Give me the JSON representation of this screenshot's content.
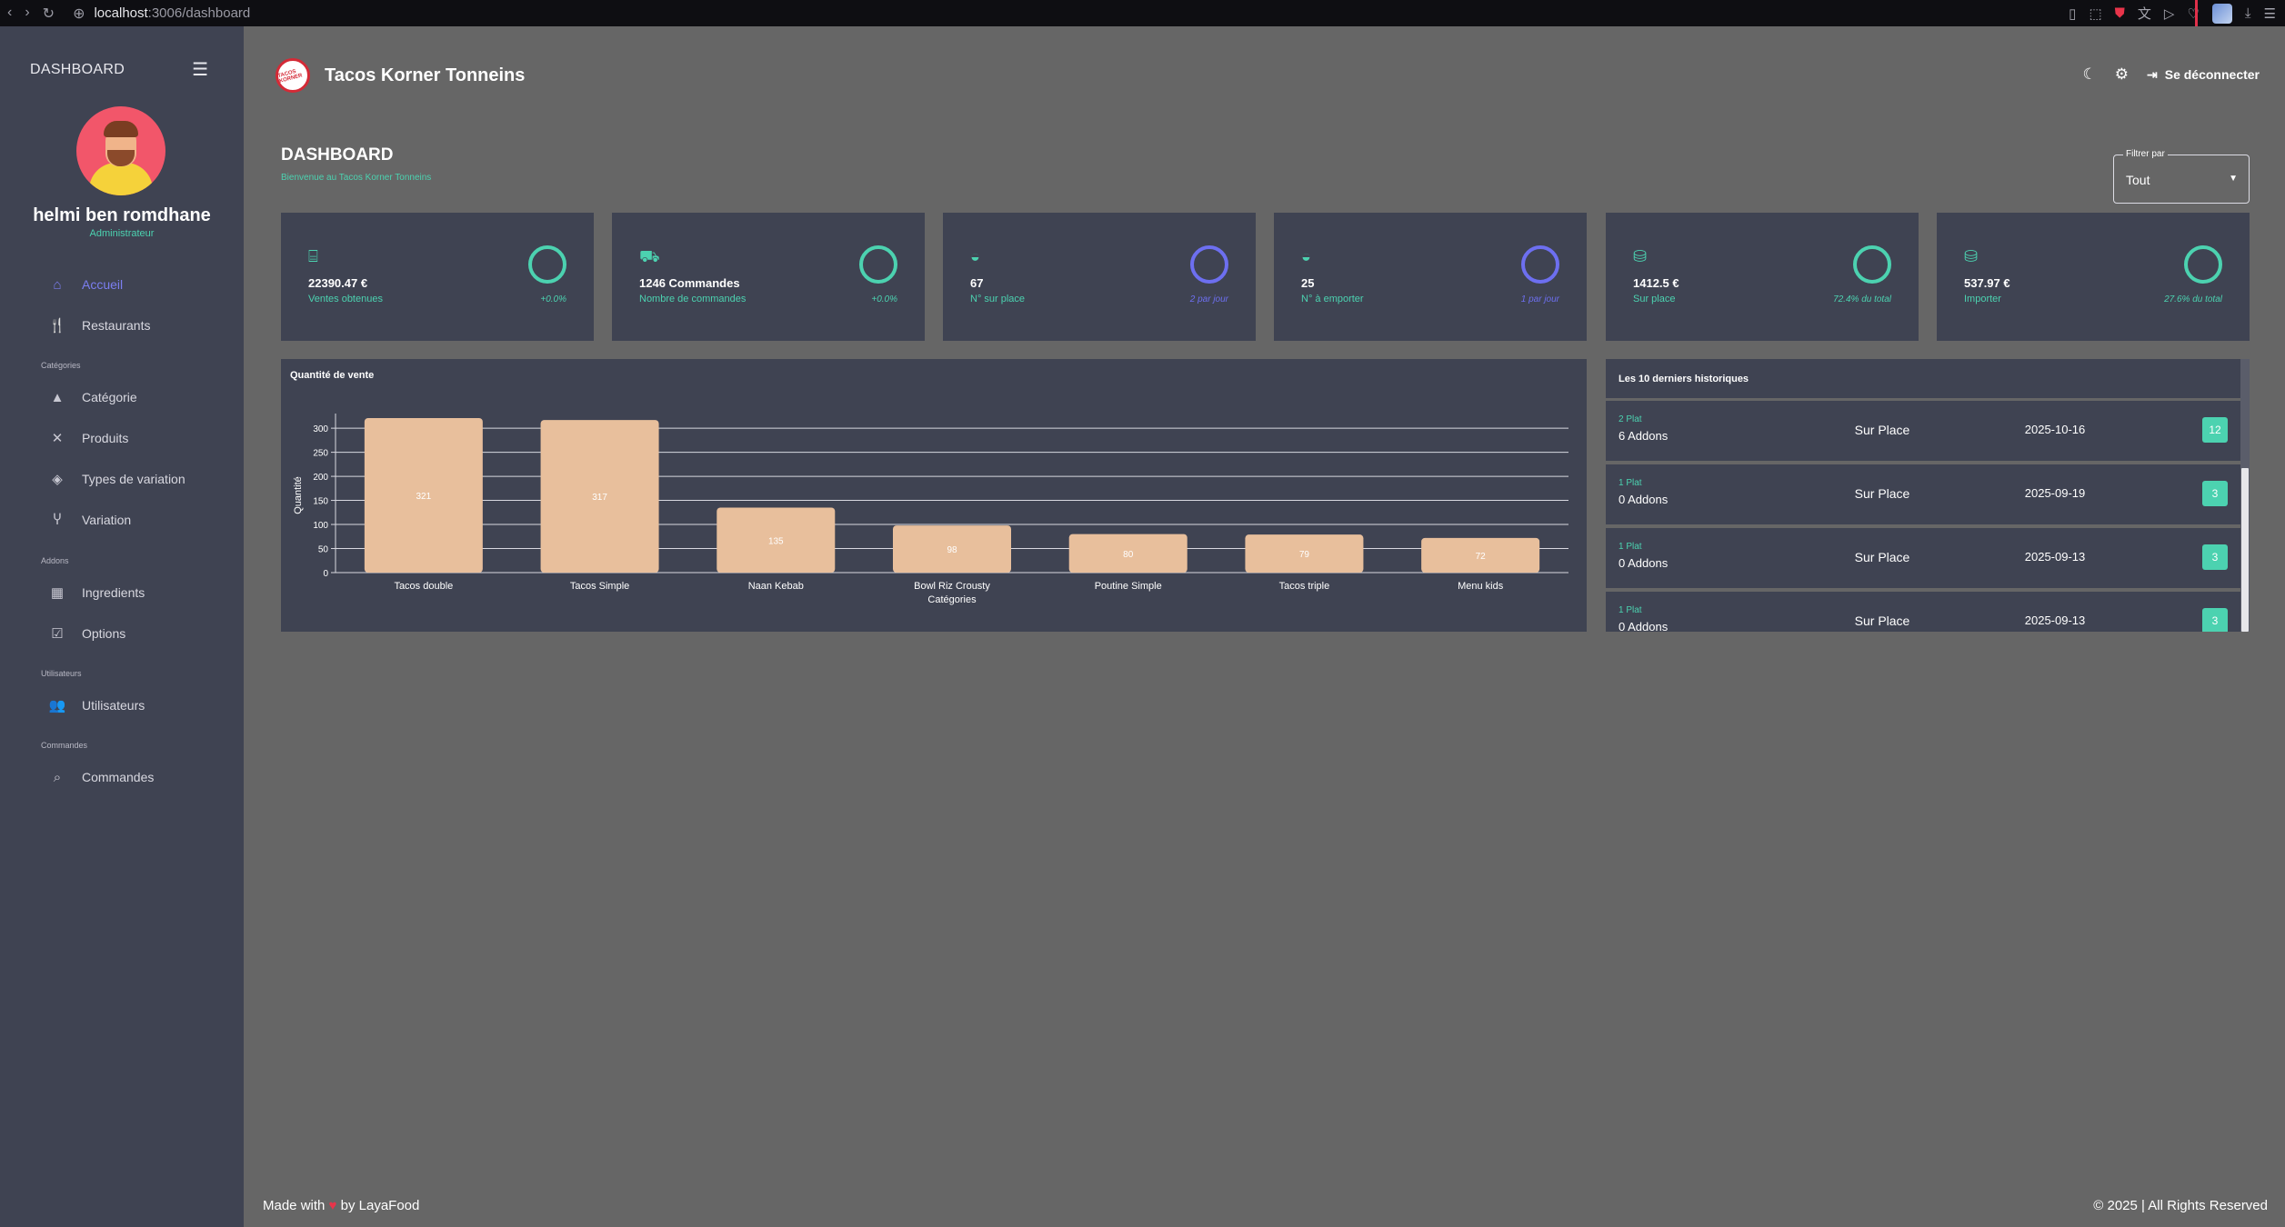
{
  "browser": {
    "host": "localhost",
    "path": ":3006/dashboard"
  },
  "sidebar": {
    "title": "DASHBOARD",
    "user": {
      "name": "helmi ben romdhane",
      "role": "Administrateur"
    },
    "items": [
      {
        "label": "Accueil",
        "icon": "home-icon"
      },
      {
        "label": "Restaurants",
        "icon": "fork-knife-icon"
      },
      {
        "label": "Catégorie",
        "icon": "shapes-icon"
      },
      {
        "label": "Produits",
        "icon": "utensils-cross-icon"
      },
      {
        "label": "Types de variation",
        "icon": "layers-icon"
      },
      {
        "label": "Variation",
        "icon": "branch-icon"
      },
      {
        "label": "Ingredients",
        "icon": "grid-icon"
      },
      {
        "label": "Options",
        "icon": "checklist-icon"
      },
      {
        "label": "Utilisateurs",
        "icon": "users-icon"
      },
      {
        "label": "Commandes",
        "icon": "search-list-icon"
      }
    ],
    "sections": [
      "Catégories",
      "Addons",
      "Utilisateurs",
      "Commandes"
    ]
  },
  "header": {
    "logo_text": "TACOS KORNER",
    "title": "Tacos Korner Tonneins",
    "logout_label": "Se déconnecter"
  },
  "page": {
    "title": "DASHBOARD",
    "subtitle": "Bienvenue au Tacos Korner Tonneins",
    "filter": {
      "label": "Filtrer par",
      "value": "Tout"
    }
  },
  "cards": [
    {
      "icon": "cash-register-icon",
      "value": "22390.47 €",
      "label": "Ventes obtenues",
      "trend": "+0.0%"
    },
    {
      "icon": "truck-icon",
      "value": "1246 Commandes",
      "label": "Nombre de commandes",
      "trend": "+0.0%"
    },
    {
      "icon": "bowl-icon",
      "value": "67",
      "label": "N° sur place",
      "trend": "2 par jour"
    },
    {
      "icon": "bowl-icon",
      "value": "25",
      "label": "N° à emporter",
      "trend": "1 par jour"
    },
    {
      "icon": "coins-icon",
      "value": "1412.5 €",
      "label": "Sur place",
      "trend": "72.4% du total"
    },
    {
      "icon": "coins-icon",
      "value": "537.97 €",
      "label": "Importer",
      "trend": "27.6% du total"
    }
  ],
  "colors": {
    "accent": "#4cd2b0",
    "accent_blue": "#6d6ff0",
    "panel": "#3f4352",
    "background": "#666666",
    "bar": "#e8bf9c"
  },
  "chart_data": {
    "type": "bar",
    "title": "Quantité de vente",
    "xlabel": "Catégories",
    "ylabel": "Quantité",
    "categories": [
      "Tacos double",
      "Tacos Simple",
      "Naan Kebab",
      "Bowl Riz Crousty",
      "Poutine Simple",
      "Tacos triple",
      "Menu kids"
    ],
    "values": [
      321,
      317,
      135,
      98,
      80,
      79,
      72
    ],
    "yticks": [
      0,
      50,
      100,
      150,
      200,
      250,
      300
    ],
    "ylim": [
      0,
      321
    ],
    "grid": true,
    "legend": "none"
  },
  "history": {
    "title": "Les 10 derniers historiques",
    "rows": [
      {
        "plat": "2 Plat",
        "addons": "6 Addons",
        "place": "Sur Place",
        "date": "2025-10-16",
        "qty": "12"
      },
      {
        "plat": "1 Plat",
        "addons": "0 Addons",
        "place": "Sur Place",
        "date": "2025-09-19",
        "qty": "3"
      },
      {
        "plat": "1 Plat",
        "addons": "0 Addons",
        "place": "Sur Place",
        "date": "2025-09-13",
        "qty": "3"
      },
      {
        "plat": "1 Plat",
        "addons": "0 Addons",
        "place": "Sur Place",
        "date": "2025-09-13",
        "qty": "3"
      }
    ]
  },
  "footer": {
    "made_with": "Made with",
    "by": "by LayaFood",
    "copyright": "© 2025 | All Rights Reserved"
  }
}
